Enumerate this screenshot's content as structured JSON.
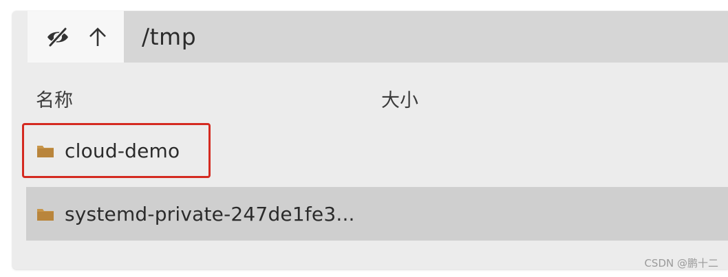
{
  "path": "/tmp",
  "columns": {
    "name": "名称",
    "size": "大小"
  },
  "files": [
    {
      "name": "cloud-demo",
      "type": "folder",
      "size": ""
    },
    {
      "name": "systemd-private-247de1fe3...",
      "type": "folder",
      "size": ""
    }
  ],
  "watermark": "CSDN @鹏十二",
  "colors": {
    "folder": "#c8964a",
    "highlight": "#d42a20",
    "selected_row": "#cfcfcf",
    "path_bar": "#d6d6d6"
  },
  "icons": {
    "hide_hidden": "eye-slash-icon",
    "go_up": "arrow-up-icon",
    "folder": "folder-icon"
  }
}
